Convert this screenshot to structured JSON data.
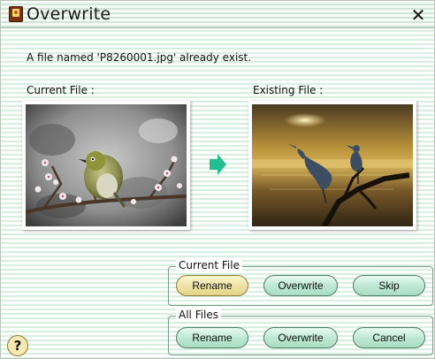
{
  "window": {
    "title": "Overwrite",
    "close_glyph": "✕"
  },
  "message": "A file named 'P8260001.jpg' already exist.",
  "current_file_label": "Current File :",
  "existing_file_label": "Existing File :",
  "icons": {
    "app": "app-icon",
    "arrow": "arrow-right-icon",
    "help": "help-icon",
    "help_glyph": "?"
  },
  "current_file_group": {
    "legend": "Current File",
    "buttons": {
      "rename": "Rename",
      "overwrite": "Overwrite",
      "skip": "Skip"
    }
  },
  "all_files_group": {
    "legend": "All Files",
    "buttons": {
      "rename": "Rename",
      "overwrite": "Overwrite",
      "cancel": "Cancel"
    }
  },
  "colors": {
    "accent_green": "#1fbf8f",
    "button_green": "#bfe8d4",
    "button_active_yellow": "#eee3a6"
  }
}
